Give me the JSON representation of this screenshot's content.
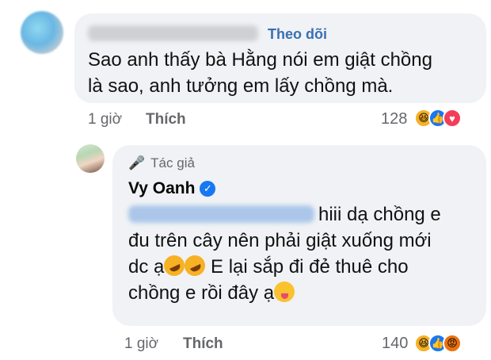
{
  "comment1": {
    "follow_label": "Theo dõi",
    "text_line1": "Sao anh thấy bà Hằng nói em giật chồng",
    "text_line2": "là sao, anh tưởng em lấy chồng mà.",
    "time": "1 giờ",
    "like_label": "Thích",
    "reaction_count": "128",
    "reactions": [
      "haha-icon",
      "like-icon",
      "love-icon"
    ]
  },
  "reply": {
    "author_badge": "Tác giả",
    "name": "Vy Oanh",
    "line1_tail": "hiii dạ chồng e",
    "line2": "đu trên cây nên phải giật xuống mới",
    "line3_a": "dc ạ",
    "line3_b": " E lại sắp đi đẻ thuê cho",
    "line4": "chồng e rồi đây ạ",
    "time": "1 giờ",
    "like_label": "Thích",
    "reaction_count": "140",
    "reactions": [
      "haha-icon",
      "like-icon",
      "angry-icon"
    ]
  },
  "colors": {
    "bubble": "#f0f2f5",
    "follow": "#3a6fb3",
    "meta": "#65676b",
    "verified": "#1877f2"
  }
}
